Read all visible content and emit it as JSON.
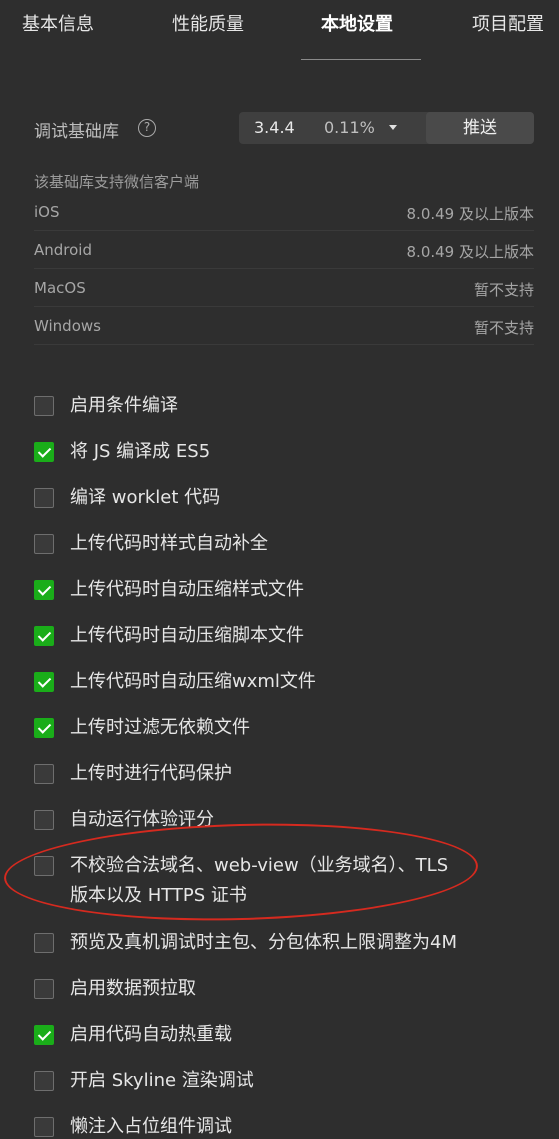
{
  "tabs": [
    {
      "label": "基本信息"
    },
    {
      "label": "性能质量"
    },
    {
      "label": "本地设置",
      "active": true
    },
    {
      "label": "项目配置"
    }
  ],
  "library": {
    "label": "调试基础库",
    "help_icon": "question-circle-icon",
    "version": "3.4.4",
    "percent": "0.11%",
    "push_label": "推送"
  },
  "support": {
    "title": "该基础库支持微信客户端",
    "rows": [
      {
        "os": "iOS",
        "value": "8.0.49 及以上版本"
      },
      {
        "os": "Android",
        "value": "8.0.49 及以上版本"
      },
      {
        "os": "MacOS",
        "value": "暂不支持"
      },
      {
        "os": "Windows",
        "value": "暂不支持"
      }
    ]
  },
  "options": [
    {
      "label": "启用条件编译",
      "checked": false
    },
    {
      "label": "将 JS 编译成 ES5",
      "checked": true
    },
    {
      "label": "编译 worklet 代码",
      "checked": false
    },
    {
      "label": "上传代码时样式自动补全",
      "checked": false
    },
    {
      "label": "上传代码时自动压缩样式文件",
      "checked": true
    },
    {
      "label": "上传代码时自动压缩脚本文件",
      "checked": true
    },
    {
      "label": "上传代码时自动压缩wxml文件",
      "checked": true
    },
    {
      "label": "上传时过滤无依赖文件",
      "checked": true
    },
    {
      "label": "上传时进行代码保护",
      "checked": false
    },
    {
      "label": "自动运行体验评分",
      "checked": false
    },
    {
      "label": "不校验合法域名、web-view（业务域名）、TLS",
      "label2": "版本以及 HTTPS 证书",
      "checked": false
    },
    {
      "label": "预览及真机调试时主包、分包体积上限调整为4M",
      "checked": false
    },
    {
      "label": "启用数据预拉取",
      "checked": false
    },
    {
      "label": "启用代码自动热重载",
      "checked": true
    },
    {
      "label": "开启 Skyline 渲染调试",
      "checked": false
    },
    {
      "label": "懒注入占位组件调试",
      "checked": false
    }
  ],
  "colors": {
    "checked": "#1aad19",
    "annotation": "#d52a1f",
    "background": "#2e2e2e"
  }
}
